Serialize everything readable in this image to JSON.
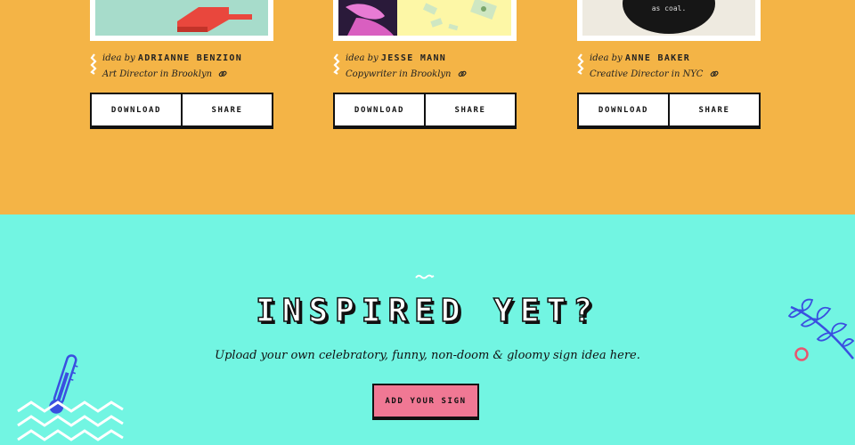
{
  "cards": [
    {
      "idea_prefix": "idea by",
      "author": "ADRIANNE BENZION",
      "role": "Art Director in Brooklyn",
      "download_label": "DOWNLOAD",
      "share_label": "SHARE"
    },
    {
      "idea_prefix": "idea by",
      "author": "JESSE MANN",
      "role": "Copywriter in Brooklyn",
      "download_label": "DOWNLOAD",
      "share_label": "SHARE"
    },
    {
      "idea_prefix": "idea by",
      "author": "ANNE BAKER",
      "role": "Creative Director in NYC",
      "download_label": "DOWNLOAD",
      "share_label": "SHARE",
      "thumb_text": "as coal."
    }
  ],
  "cta_section": {
    "headline": "INSPIRED YET?",
    "subline": "Upload your own celebratory, funny, non-doom & gloomy sign idea here.",
    "button_label": "ADD YOUR SIGN"
  },
  "colors": {
    "top_background": "#f4b446",
    "bottom_background": "#72f5e2",
    "cta_button": "#f07894",
    "decor_blue": "#3a4fe0"
  },
  "icons": [
    "squiggle-icon",
    "link-icon",
    "wave-icon",
    "thermometer-icon",
    "zigzag-lines-icon",
    "leaf-branch-icon",
    "ring-icon"
  ]
}
